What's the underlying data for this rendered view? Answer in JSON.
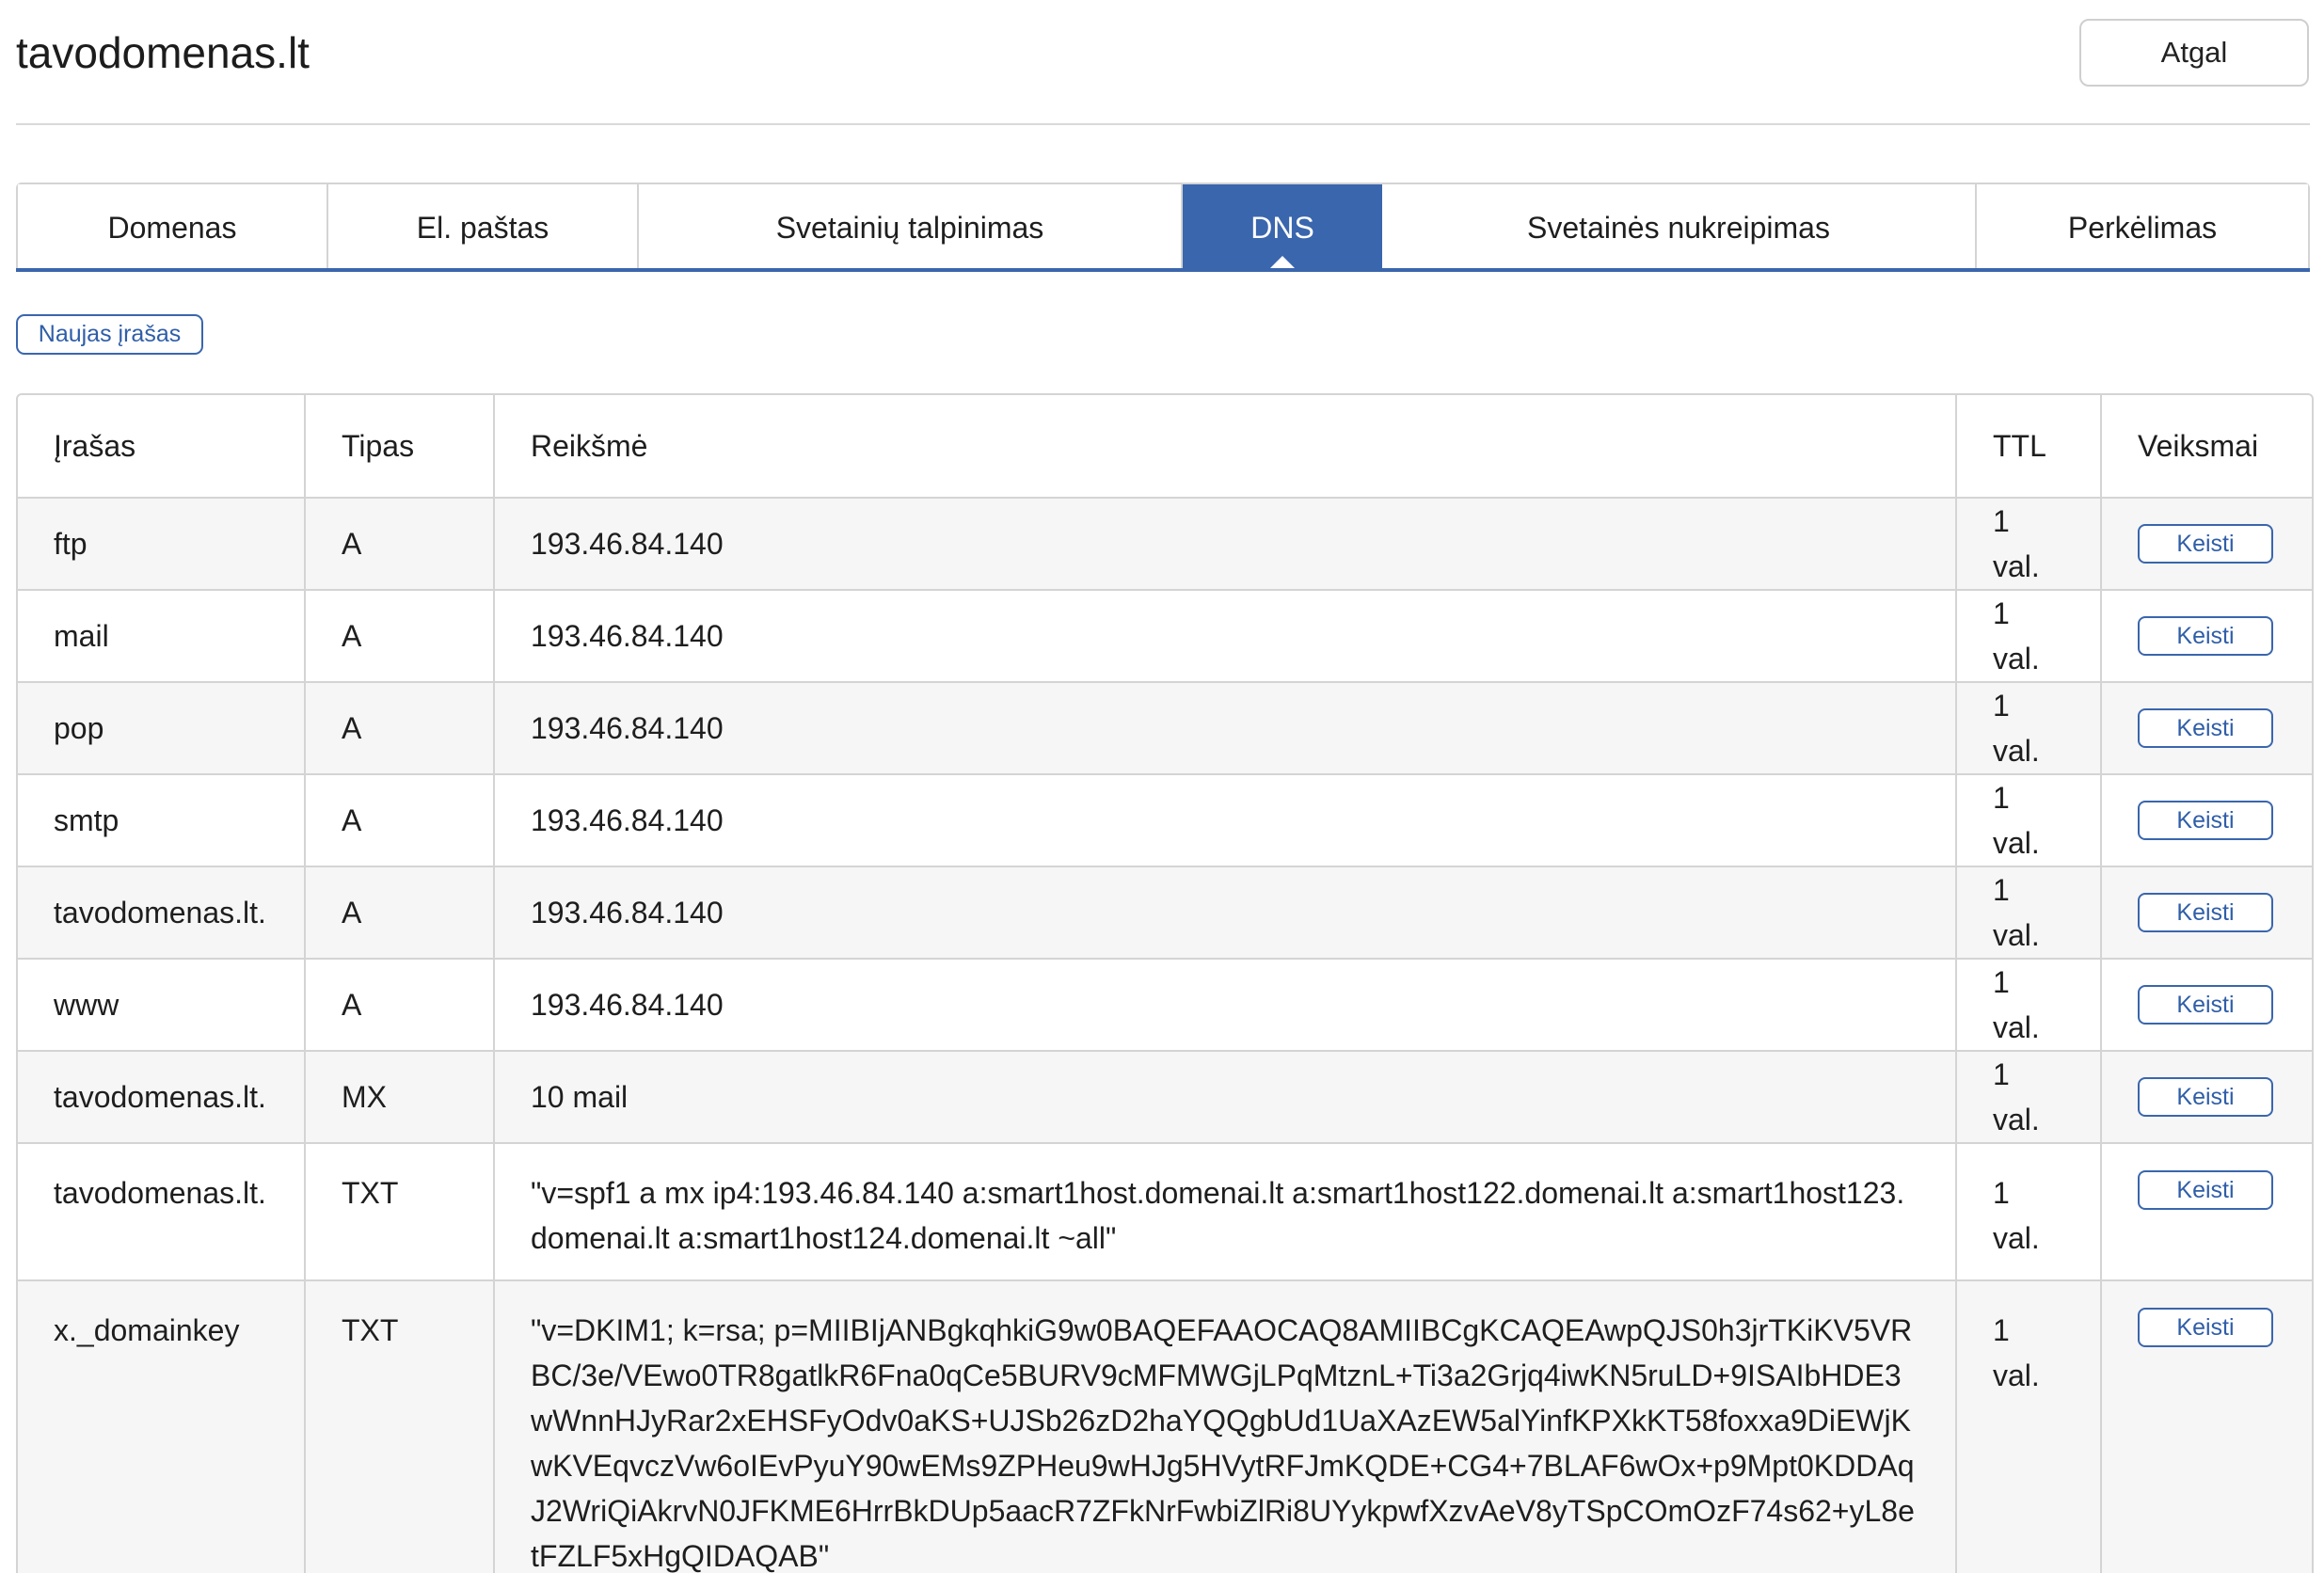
{
  "header": {
    "title": "tavodomenas.lt",
    "back_label": "Atgal"
  },
  "tabs": [
    {
      "label": "Domenas",
      "active": false
    },
    {
      "label": "El. paštas",
      "active": false
    },
    {
      "label": "Svetainių talpinimas",
      "active": false
    },
    {
      "label": "DNS",
      "active": true
    },
    {
      "label": "Svetainės nukreipimas",
      "active": false
    },
    {
      "label": "Perkėlimas",
      "active": false
    }
  ],
  "new_record_label": "Naujas įrašas",
  "table": {
    "columns": [
      "Įrašas",
      "Tipas",
      "Reikšmė",
      "TTL",
      "Veiksmai"
    ],
    "edit_label": "Keisti",
    "rows": [
      {
        "record": "ftp",
        "type": "A",
        "value": "193.46.84.140",
        "ttl": "1 val."
      },
      {
        "record": "mail",
        "type": "A",
        "value": "193.46.84.140",
        "ttl": "1 val."
      },
      {
        "record": "pop",
        "type": "A",
        "value": "193.46.84.140",
        "ttl": "1 val."
      },
      {
        "record": "smtp",
        "type": "A",
        "value": "193.46.84.140",
        "ttl": "1 val."
      },
      {
        "record": "tavodomenas.lt.",
        "type": "A",
        "value": "193.46.84.140",
        "ttl": "1 val."
      },
      {
        "record": "www",
        "type": "A",
        "value": "193.46.84.140",
        "ttl": "1 val."
      },
      {
        "record": "tavodomenas.lt.",
        "type": "MX",
        "value": "10 mail",
        "ttl": "1 val."
      },
      {
        "record": "tavodomenas.lt.",
        "type": "TXT",
        "value": "\"v=spf1 a mx ip4:193.46.84.140 a:smart1host.domenai.lt a:smart1host122.domenai.lt a:smart1host123.domenai.lt a:smart1host124.domenai.lt ~all\"",
        "ttl": "1 val."
      },
      {
        "record": "x._domainkey",
        "type": "TXT",
        "value": "\"v=DKIM1; k=rsa; p=MIIBIjANBgkqhkiG9w0BAQEFAAOCAQ8AMIIBCgKCAQEAwpQJS0h3jrTKiKV5VRBC/3e/VEwo0TR8gatlkR6Fna0qCe5BURV9cMFMWGjLPqMtznL+Ti3a2Grjq4iwKN5ruLD+9ISAIbHDE3wWnnHJyRar2xEHSFyOdv0aKS+UJSb26zD2haYQQgbUd1UaXAzEW5alYinfKPXkKT58foxxa9DiEWjKwKVEqvczVw6oIEvPyuY90wEMs9ZPHeu9wHJg5HVytRFJmKQDE+CG4+7BLAF6wOx+p9Mpt0KDDAqJ2WriQiAkrvN0JFKME6HrrBkDUp5aacR7ZFkNrFwbiZlRi8UYykpwfXzvAeV8yTSpCOmOzF74s62+yL8etFZLF5xHgQIDAQAB\"",
        "ttl": "1 val."
      }
    ]
  }
}
